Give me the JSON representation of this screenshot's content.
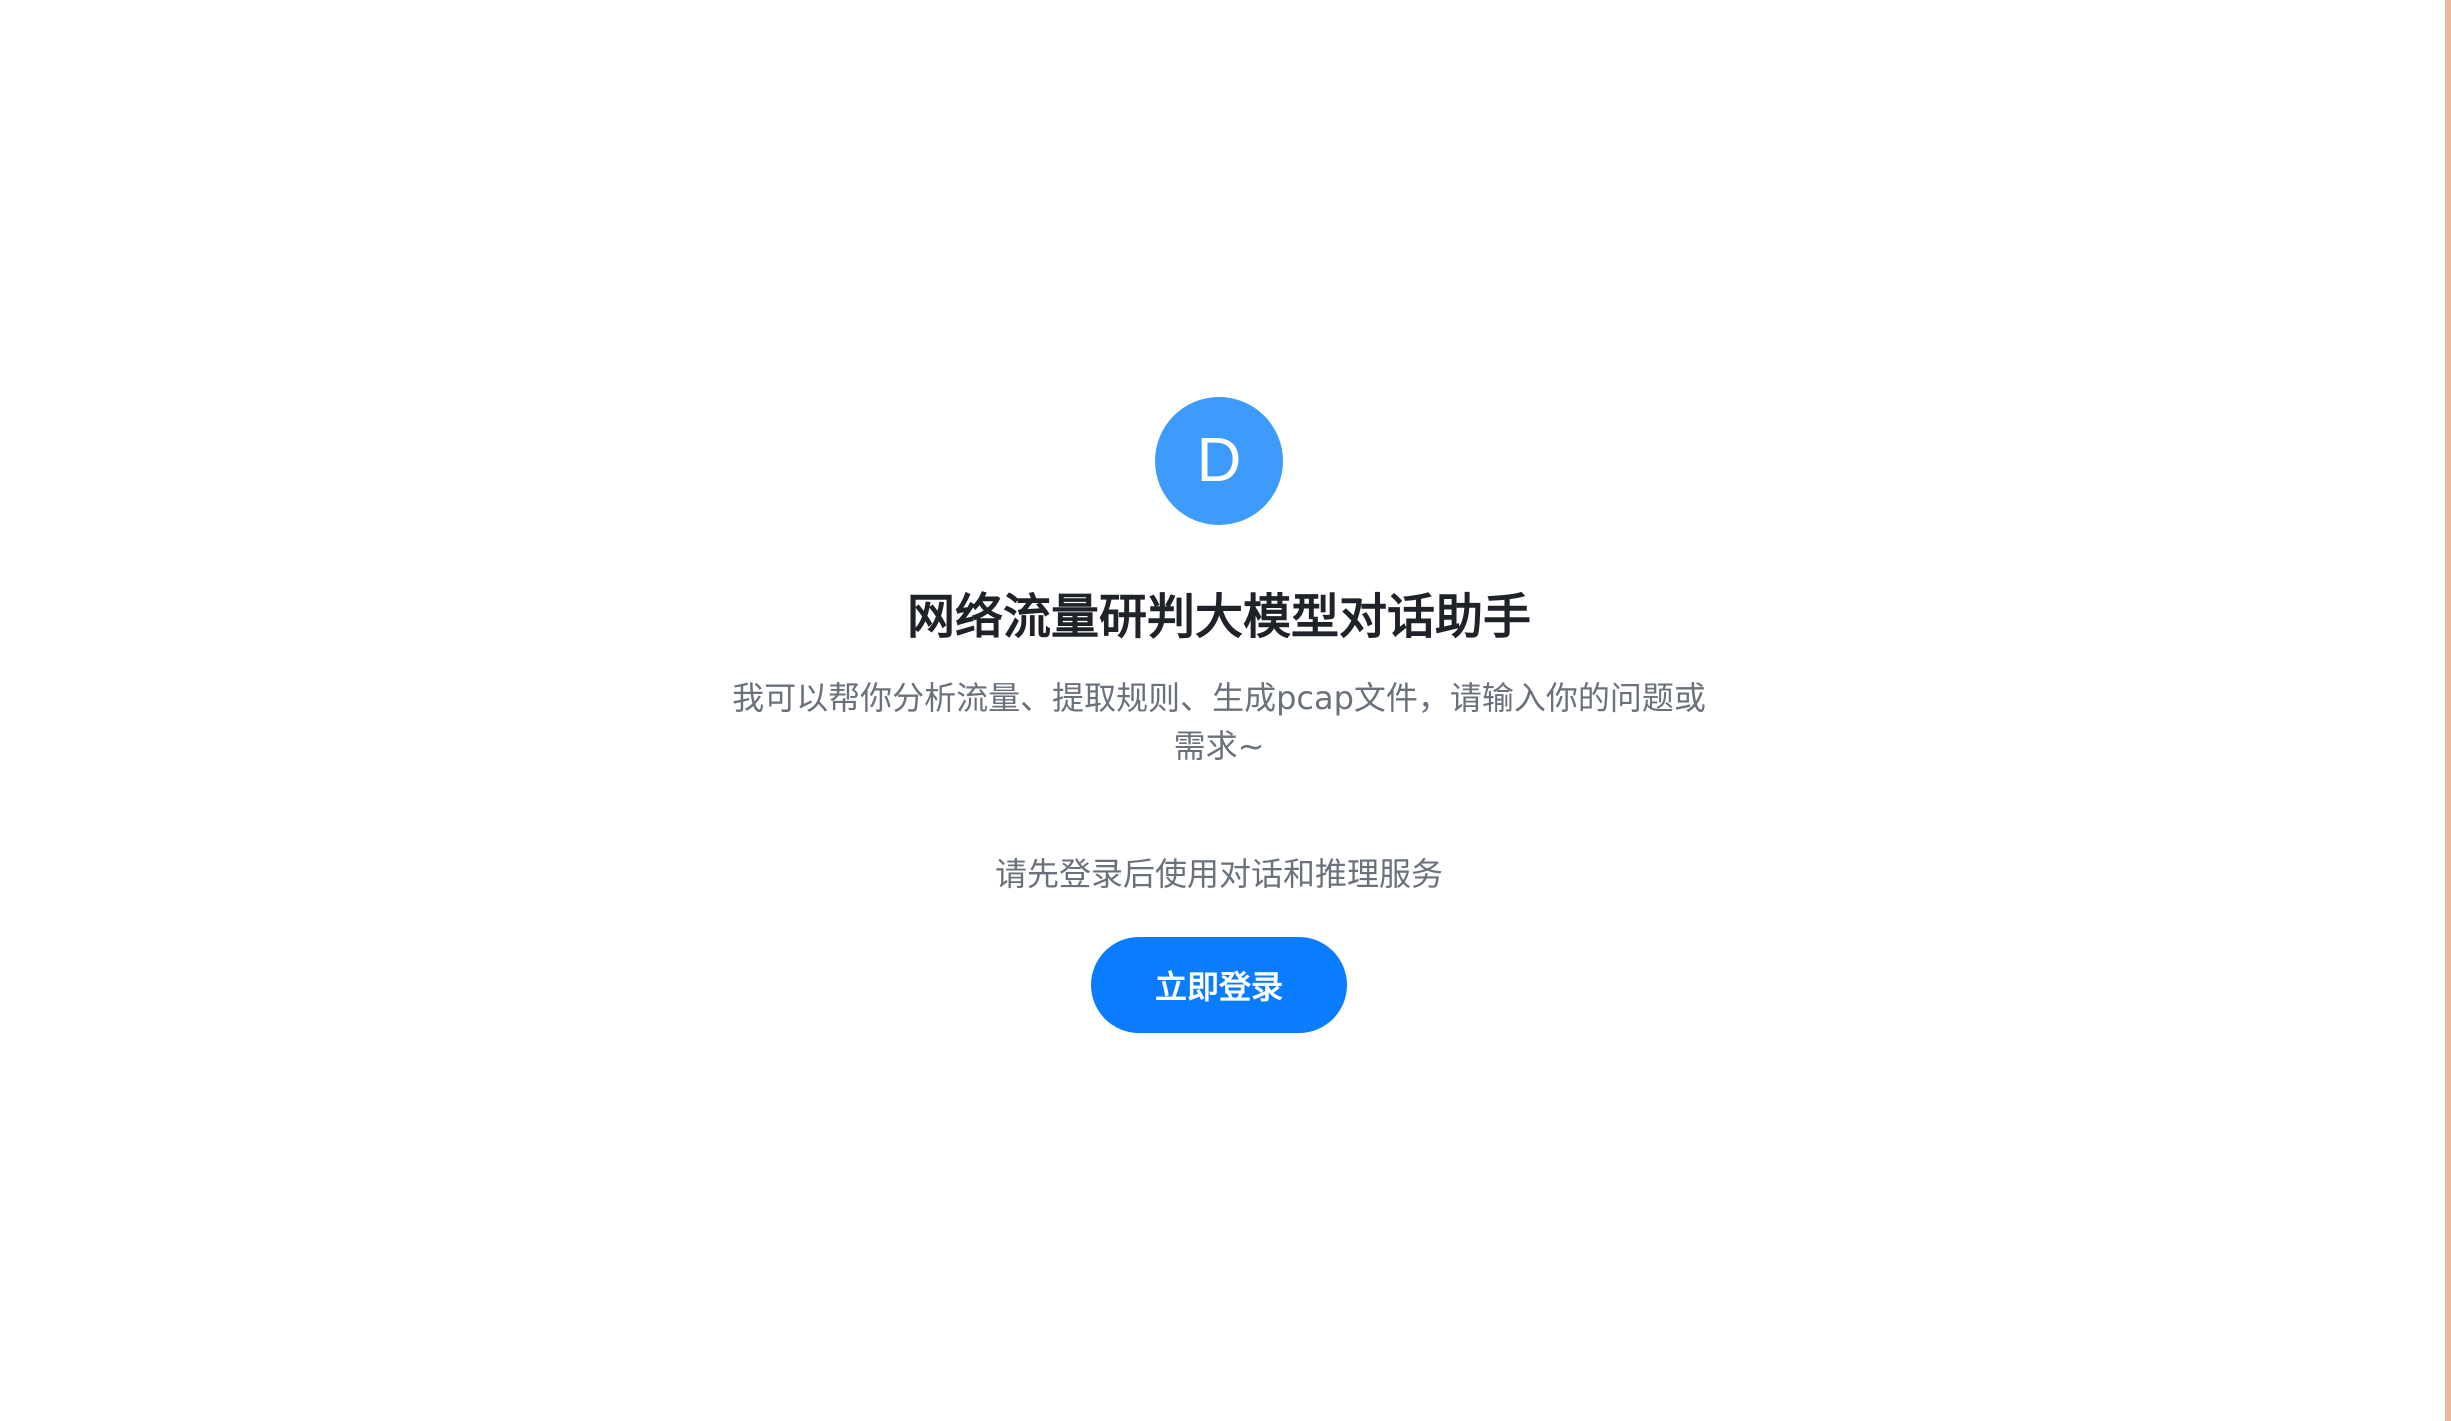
{
  "colors": {
    "avatar_bg": "#3d9bfb",
    "button_bg": "#0a7cff",
    "edge_strip": "#e8b99a"
  },
  "welcome": {
    "avatar_letter": "D",
    "title": "网络流量研判大模型对话助手",
    "subtitle": "我可以帮你分析流量、提取规则、生成pcap文件，请输入你的问题或需求~",
    "login_hint": "请先登录后使用对话和推理服务",
    "login_button": "立即登录"
  }
}
